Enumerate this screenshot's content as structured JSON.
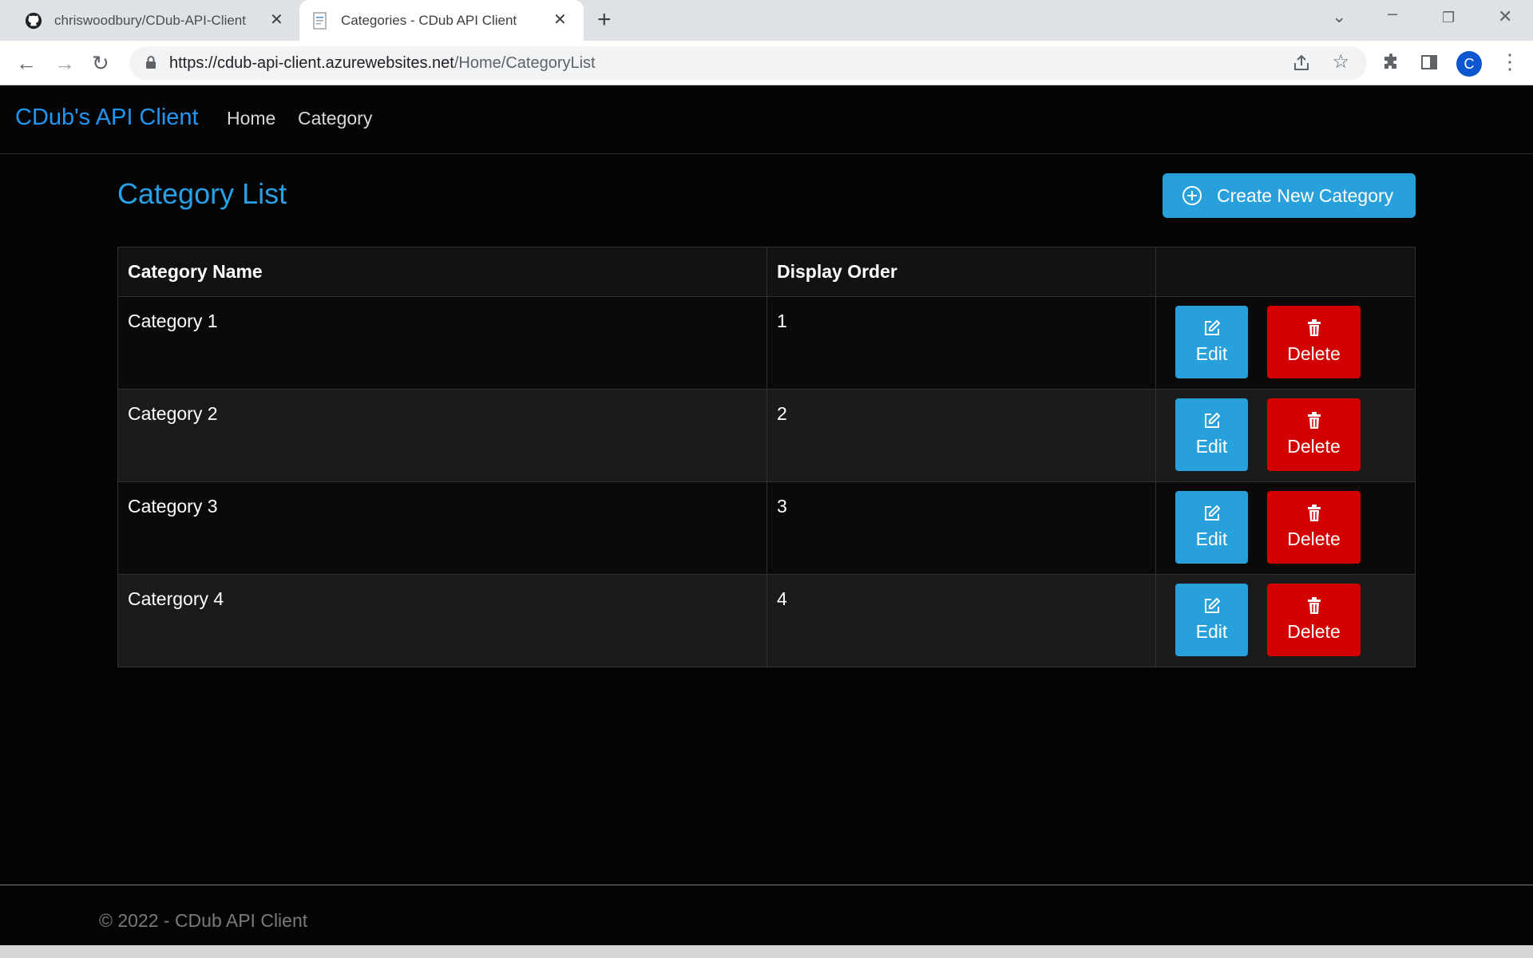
{
  "browser": {
    "tabs": [
      {
        "title": "chriswoodbury/CDub-API-Client",
        "icon": "github-icon",
        "active": false
      },
      {
        "title": "Categories - CDub API Client",
        "icon": "document-icon",
        "active": true
      }
    ],
    "url_host": "https://cdub-api-client.azurewebsites.net",
    "url_path": "/Home/CategoryList",
    "profile_initial": "C"
  },
  "navbar": {
    "brand": "CDub's API Client",
    "links": [
      "Home",
      "Category"
    ]
  },
  "main": {
    "title": "Category List",
    "create_button": "Create New Category",
    "table": {
      "headers": [
        "Category Name",
        "Display Order",
        ""
      ],
      "rows": [
        {
          "name": "Category 1",
          "order": "1"
        },
        {
          "name": "Category 2",
          "order": "2"
        },
        {
          "name": "Category 3",
          "order": "3"
        },
        {
          "name": "Catergory 4",
          "order": "4"
        }
      ],
      "edit_label": "Edit",
      "delete_label": "Delete"
    }
  },
  "footer": {
    "text": "© 2022 - CDub API Client"
  },
  "colors": {
    "accent": "#28a0dc",
    "brand": "#2196f3",
    "danger": "#d20000",
    "background": "#040404"
  }
}
